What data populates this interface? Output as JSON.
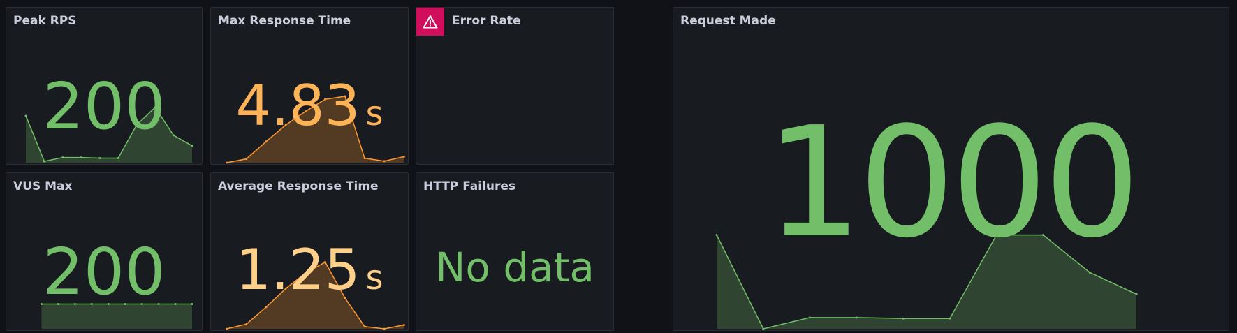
{
  "theme": {
    "green": "#73bf69",
    "orange": "#ff9830",
    "light_orange": "#ffb357",
    "error_badge": "#d10e5c"
  },
  "panels": {
    "peak_rps": {
      "title": "Peak RPS",
      "value": "200",
      "sparkline": [
        0.72,
        0.02,
        0.08,
        0.08,
        0.07,
        0.07,
        0.58,
        0.85,
        0.42,
        0.26
      ]
    },
    "max_response_time": {
      "title": "Max Response Time",
      "value": "4.83",
      "unit": "s",
      "sparkline": [
        0.0,
        0.05,
        0.28,
        0.5,
        0.68,
        0.84,
        0.88,
        0.06,
        0.02,
        0.08
      ]
    },
    "error_rate": {
      "title": "Error Rate",
      "icon": "warning-triangle-icon"
    },
    "vus_max": {
      "title": "VUS Max",
      "value": "200",
      "sparkline": [
        0.32,
        0.32,
        0.32,
        0.32,
        0.32,
        0.32,
        0.32,
        0.32,
        0.32,
        0.32
      ]
    },
    "average_response_time": {
      "title": "Average Response Time",
      "value": "1.25",
      "unit": "s",
      "sparkline": [
        0.0,
        0.06,
        0.28,
        0.52,
        0.72,
        0.86,
        0.4,
        0.03,
        0.0,
        0.05
      ]
    },
    "http_failures": {
      "title": "HTTP Failures",
      "value": "No data"
    },
    "request_made": {
      "title": "Request Made",
      "value": "1000",
      "sparkline": [
        1.0,
        0.0,
        0.12,
        0.12,
        0.11,
        0.11,
        1.0,
        1.0,
        0.6,
        0.37
      ]
    }
  }
}
